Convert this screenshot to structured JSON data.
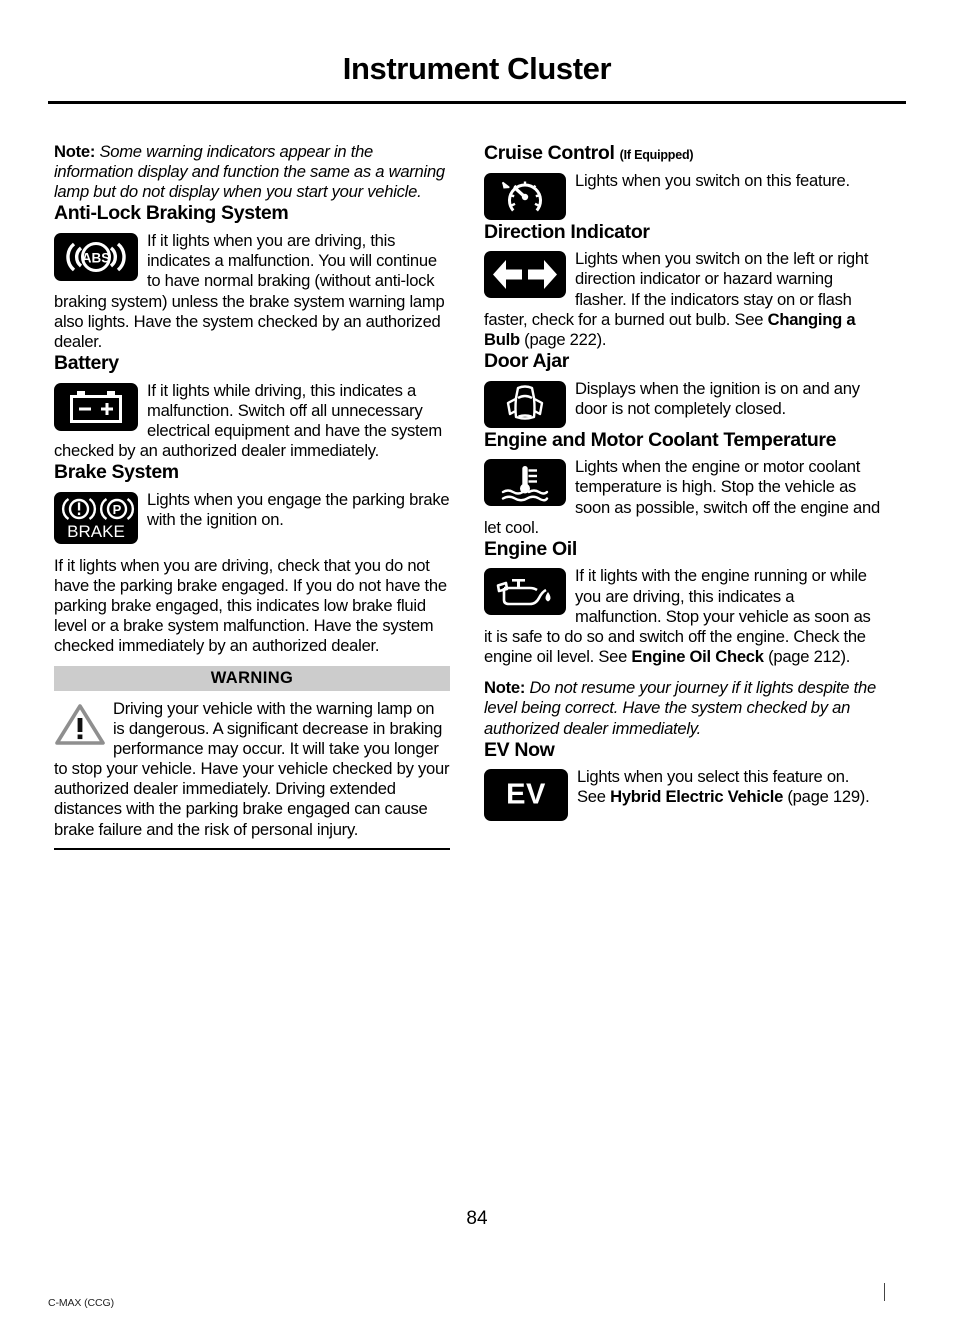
{
  "header": {
    "title": "Instrument Cluster"
  },
  "footer": {
    "page_number": "84",
    "model": "C-MAX (CCG)"
  },
  "left_column": {
    "intro_note": {
      "label": "Note:",
      "text": " Some warning indicators appear in the information display and function the same as a warning lamp but do not display when you start your vehicle."
    },
    "sections": [
      {
        "title": "Anti-Lock Braking System",
        "icon": "abs-warning-icon",
        "body": "If it lights when you are driving, this indicates a malfunction. You will continue to have normal braking (without anti-lock braking system) unless the brake system warning lamp also lights. Have the system checked by an authorized dealer."
      },
      {
        "title": "Battery",
        "icon": "battery-warning-icon",
        "body": "If it lights while driving, this indicates a malfunction. Switch off all unnecessary electrical equipment and have the system checked by an authorized dealer immediately."
      },
      {
        "title": "Brake System",
        "icon": "brake-system-warning-icon",
        "icon_label": "BRAKE",
        "body": "Lights when you engage the parking brake with the ignition on.",
        "body2": "If it lights when you are driving, check that you do not have the parking brake engaged. If you do not have the parking brake engaged, this indicates low brake fluid level or a brake system malfunction. Have the system checked immediately by an authorized dealer."
      }
    ],
    "warning_block": {
      "heading": "WARNING",
      "icon": "warning-triangle-icon",
      "text": "Driving your vehicle with the warning lamp on is dangerous. A significant decrease in braking performance may occur. It will take you longer to stop your vehicle. Have your vehicle checked by your authorized dealer immediately. Driving extended distances with the parking brake engaged can cause brake failure and the risk of personal injury."
    }
  },
  "right_column": {
    "sections": [
      {
        "title": "Cruise Control",
        "title_suffix": "(If Equipped)",
        "icon": "cruise-control-icon",
        "body": "Lights when you switch on this feature."
      },
      {
        "title": "Direction Indicator",
        "icon": "direction-indicator-icon",
        "body_part1": "Lights when you switch on the left or right direction indicator or hazard warning flasher. If the indicators stay on or flash faster, check for a burned out bulb.  See ",
        "body_bold": "Changing a Bulb",
        "body_part2": " (page 222)."
      },
      {
        "title": "Door Ajar",
        "icon": "door-ajar-icon",
        "body": "Displays when the ignition is on and any door is not completely closed."
      },
      {
        "title": "Engine and Motor Coolant Temperature",
        "icon": "coolant-temperature-icon",
        "body": "Lights when the engine or motor coolant temperature is high. Stop the vehicle as soon as possible, switch off the engine and let cool."
      },
      {
        "title": "Engine Oil",
        "icon": "engine-oil-icon",
        "body_part1": "If it lights with the engine running or while you are driving, this indicates a malfunction. Stop your vehicle as soon as it is safe to do so and switch off the engine. Check the engine oil level.  See ",
        "body_bold": "Engine Oil Check",
        "body_part2": " (page 212).",
        "note_label": "Note:",
        "note_text": " Do not resume your journey if it lights despite the level being correct. Have the system checked by an authorized dealer immediately."
      },
      {
        "title": "EV Now",
        "icon": "ev-now-icon",
        "icon_label": "EV",
        "body_part1": "Lights when you select this feature on. See ",
        "body_bold": "Hybrid Electric Vehicle",
        "body_part2": " (page 129)."
      }
    ]
  },
  "colors": {
    "icon_tile_background": "#000000",
    "icon_glyph": "#ffffff",
    "warning_bar_background": "#cccccc",
    "text": "#000000"
  }
}
